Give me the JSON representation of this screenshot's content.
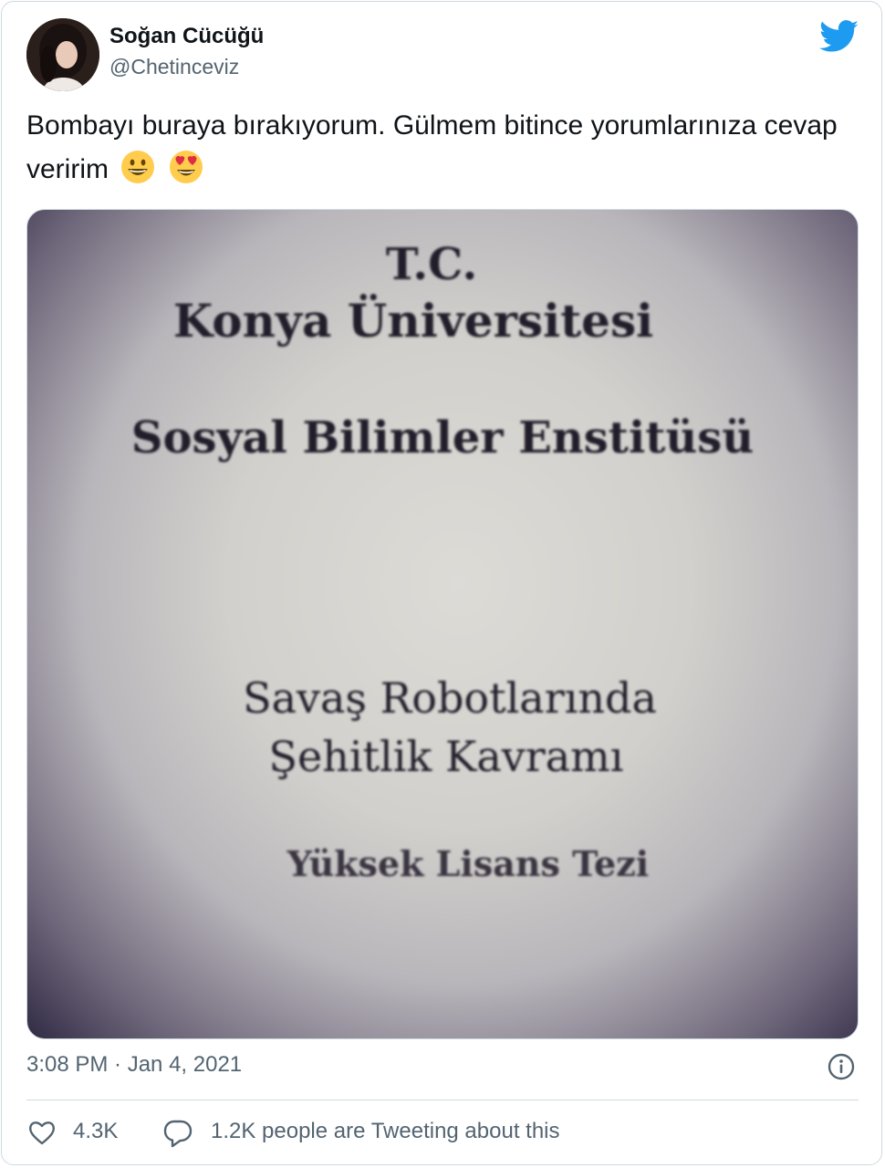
{
  "author": {
    "display_name": "Soğan Cücüğü",
    "handle": "@Chetinceviz"
  },
  "tweet": {
    "text": "Bombayı buraya bırakıyorum. Gülmem bitince yorumlarınıza cevap veririm",
    "emojis": [
      "grinning-face",
      "smiling-face-with-heart-eyes"
    ]
  },
  "media": {
    "lines": {
      "tc": "T.C.",
      "university": "Konya Üniversitesi",
      "institute": "Sosyal Bilimler Enstitüsü",
      "title_line1": "Savaş Robotlarında",
      "title_line2": "Şehitlik Kavramı",
      "degree": "Yüksek Lisans Tezi"
    }
  },
  "meta": {
    "timestamp": "3:08 PM · Jan 4, 2021"
  },
  "actions": {
    "like_count": "4.3K",
    "tweeting_text": "1.2K people are Tweeting about this"
  },
  "colors": {
    "brand": "#1d9bf0",
    "text": "#0f1419",
    "secondary": "#536471",
    "border": "#cfd9de"
  },
  "icons": [
    "twitter-bird-icon",
    "info-icon",
    "heart-icon",
    "reply-bubble-icon"
  ]
}
